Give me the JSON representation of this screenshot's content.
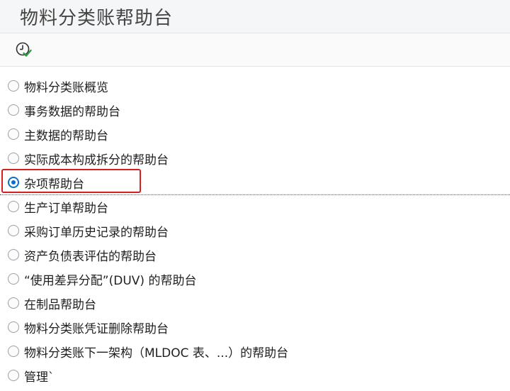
{
  "window": {
    "title": "物料分类账帮助台"
  },
  "toolbar": {
    "execute_icon": "clock-check-icon"
  },
  "options": [
    {
      "label": "物料分类账概览",
      "selected": false
    },
    {
      "label": "事务数据的帮助台",
      "selected": false
    },
    {
      "label": "主数据的帮助台",
      "selected": false
    },
    {
      "label": "实际成本构成拆分的帮助台",
      "selected": false
    },
    {
      "label": "杂项帮助台",
      "selected": true
    },
    {
      "label": "生产订单帮助台",
      "selected": false
    },
    {
      "label": "采购订单历史记录的帮助台",
      "selected": false
    },
    {
      "label": "资产负债表评估的帮助台",
      "selected": false
    },
    {
      "label": "“使用差异分配”(DUV) 的帮助台",
      "selected": false
    },
    {
      "label": "在制品帮助台",
      "selected": false
    },
    {
      "label": "物料分类账凭证删除帮助台",
      "selected": false
    },
    {
      "label": "物料分类账下一架构（MLDOC 表、...）的帮助台",
      "selected": false
    },
    {
      "label": "管理`",
      "selected": false
    }
  ],
  "colors": {
    "accent": "#0a6ed1",
    "highlight_box": "#d61f1f",
    "check": "#2e9e44"
  }
}
